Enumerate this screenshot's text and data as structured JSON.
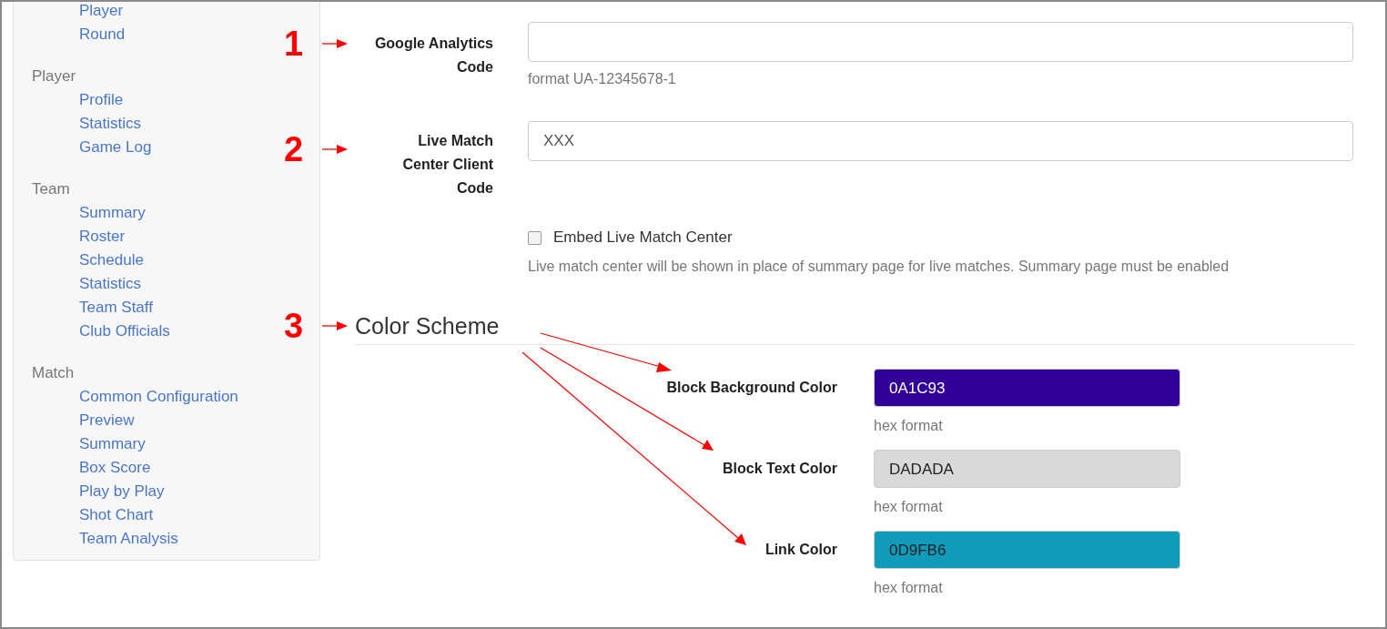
{
  "sidebar": {
    "groups": [
      {
        "items": [
          "Player",
          "Round"
        ]
      },
      {
        "heading": "Player",
        "items": [
          "Profile",
          "Statistics",
          "Game Log"
        ]
      },
      {
        "heading": "Team",
        "items": [
          "Summary",
          "Roster",
          "Schedule",
          "Statistics",
          "Team Staff",
          "Club Officials"
        ]
      },
      {
        "heading": "Match",
        "items": [
          "Common Configuration",
          "Preview",
          "Summary",
          "Box Score",
          "Play by Play",
          "Shot Chart",
          "Team Analysis"
        ]
      }
    ]
  },
  "fields": [
    {
      "label": "Google Analytics Code",
      "help": "format UA-12345678-1"
    },
    {
      "label": "Live Match Center Client Code",
      "value": "XXX"
    }
  ],
  "embed_checkbox": {
    "label": "Embed Live Match Center",
    "checked": false,
    "help": "Live match center will be shown in place of summary page for live matches. Summary page must be enabled"
  },
  "color_scheme": {
    "heading": "Color Scheme",
    "colors": [
      {
        "label": "Block Background Color",
        "value": "0A1C93",
        "color": "#300099",
        "help": "hex format"
      },
      {
        "label": "Block Text Color",
        "value": "DADADA",
        "color": "#d9d9d9",
        "help": "hex format"
      },
      {
        "label": "Link Color",
        "value": "0D9FB6",
        "color": "#0f9bb9",
        "help": "hex format"
      }
    ]
  },
  "annotations": [
    "1",
    "2",
    "3"
  ]
}
